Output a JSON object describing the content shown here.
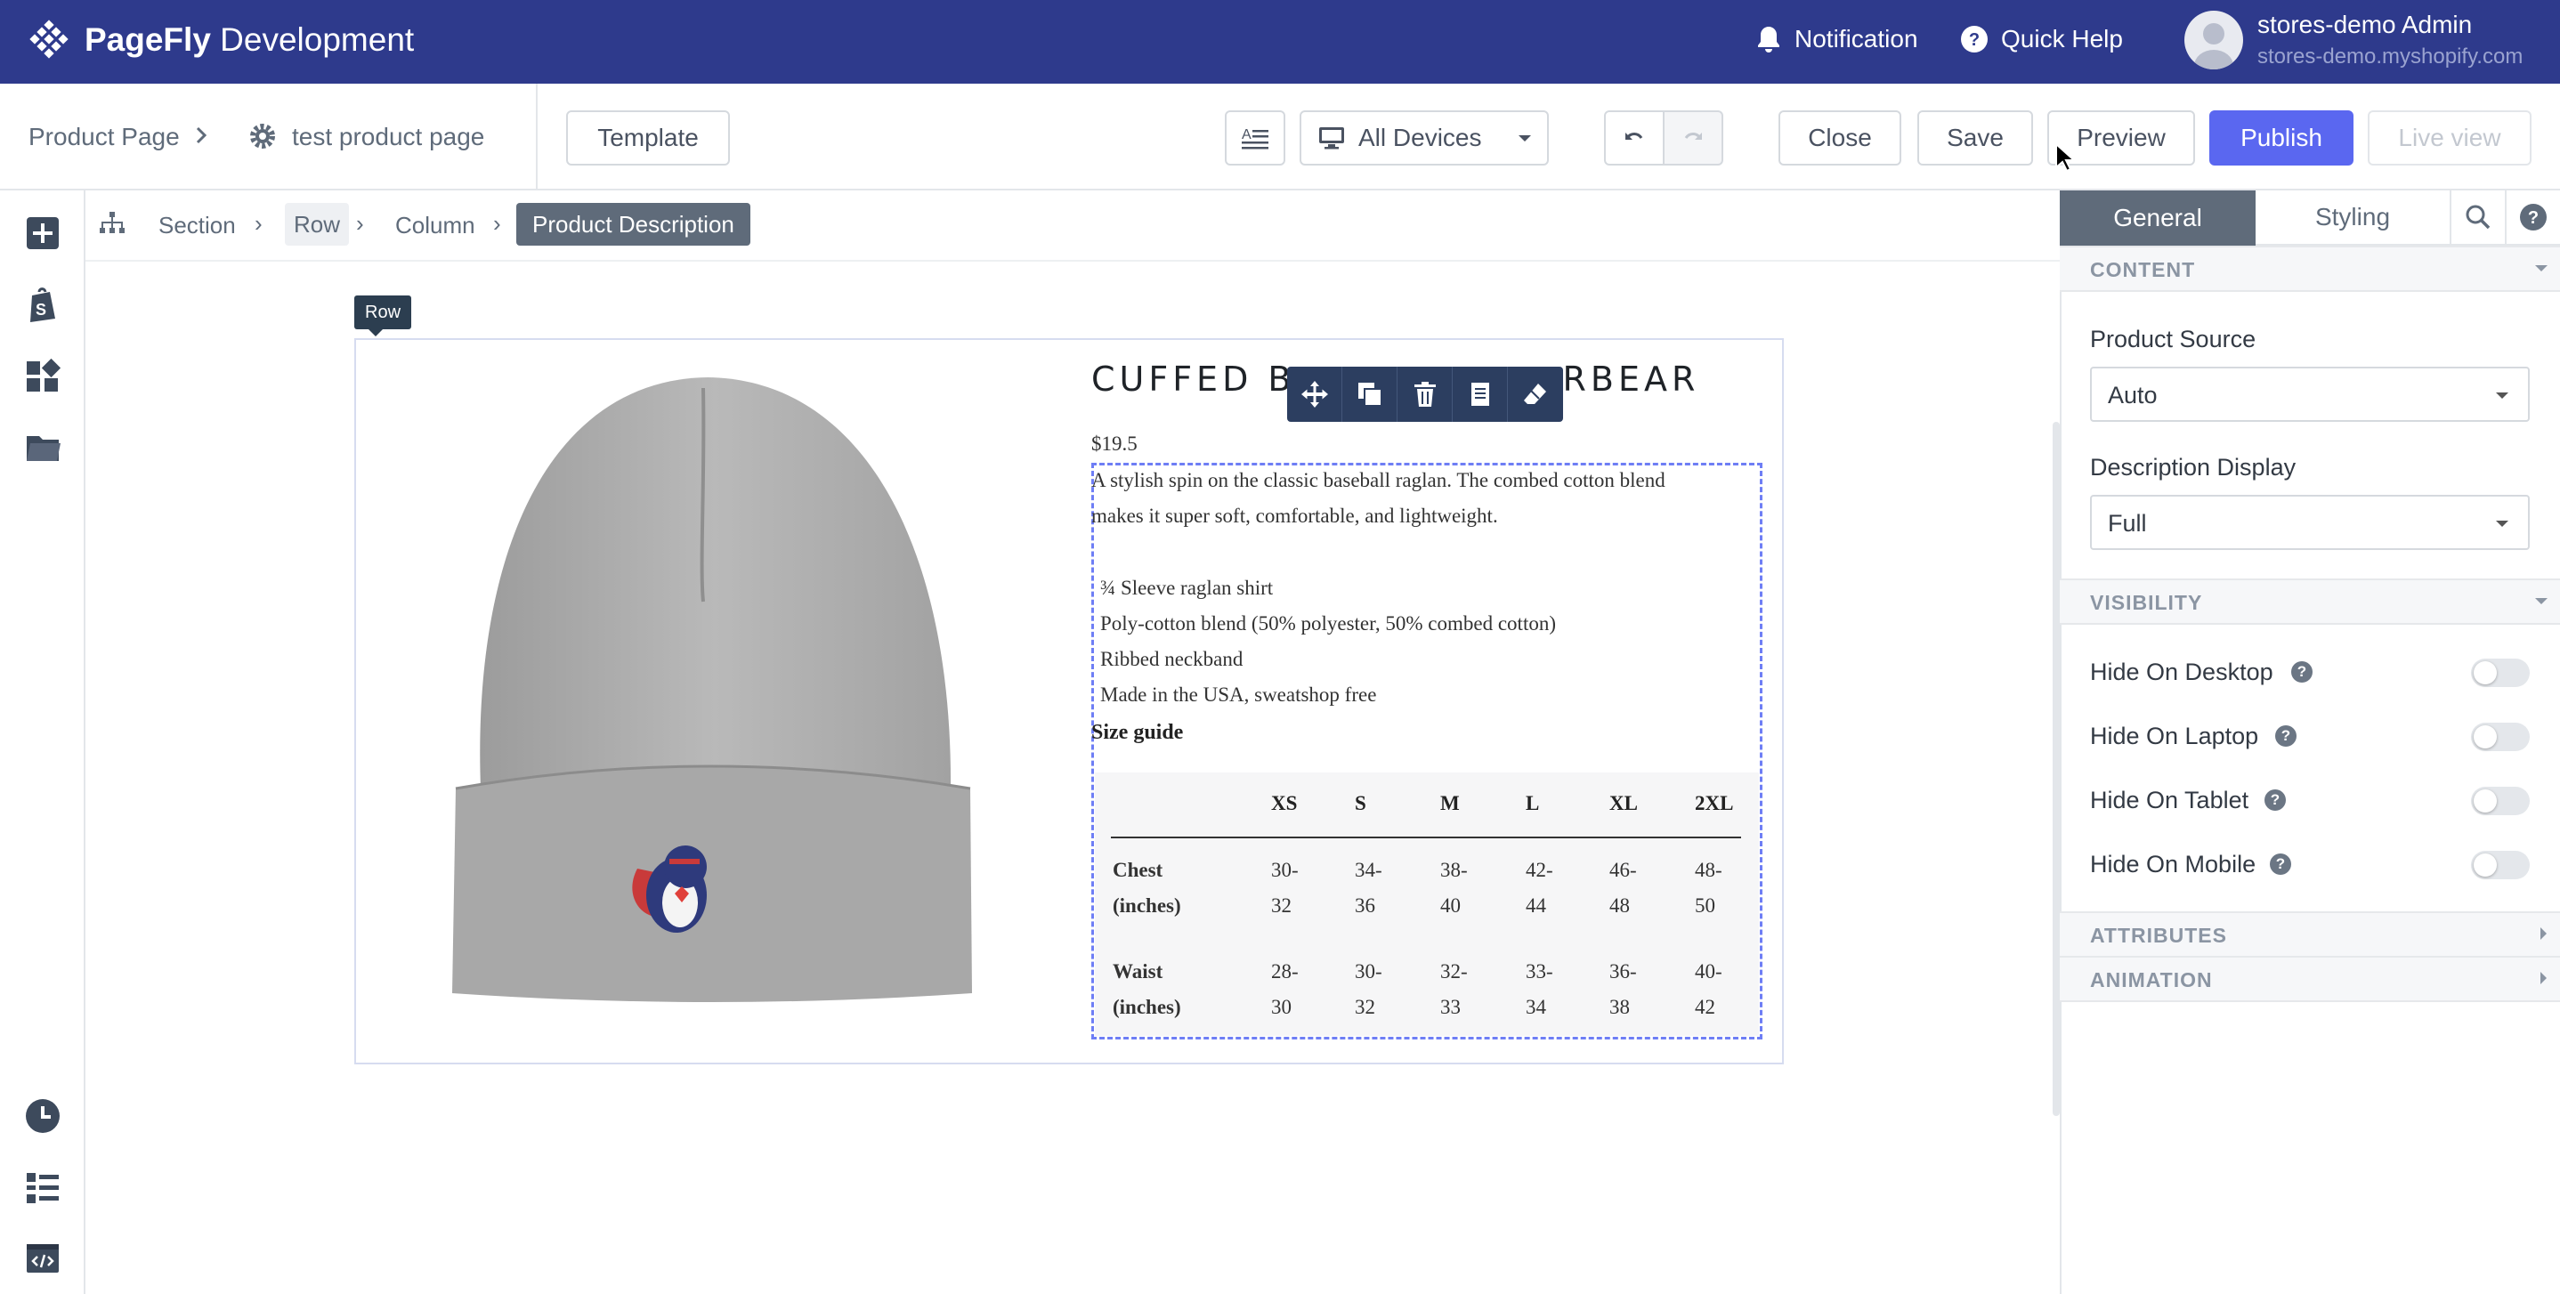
{
  "app": {
    "brand_bold": "PageFly",
    "brand_rest": " Development",
    "notification_label": "Notification",
    "quick_help_label": "Quick Help",
    "user_name": "stores-demo Admin",
    "user_domain": "stores-demo.myshopify.com",
    "colors": {
      "topbar": "#2e3a8c",
      "accent": "#5a67f0",
      "active_tab": "#5f6b7a"
    }
  },
  "toolbar": {
    "crumb_parent": "Product Page",
    "crumb_page": "test product page",
    "template_label": "Template",
    "device_label": "All Devices",
    "close_label": "Close",
    "save_label": "Save",
    "preview_label": "Preview",
    "publish_label": "Publish",
    "live_view_label": "Live view"
  },
  "breadcrumb": [
    "Section",
    "Row",
    "Column",
    "Product Description"
  ],
  "canvas": {
    "row_label": "Row",
    "product_title": "CUFFED BEANIE SUPERBEAR",
    "title_left": "CUFFED B",
    "title_right": "RBEAR",
    "price": "$19.5",
    "description_lines": [
      "A stylish spin on the classic baseball raglan. The combed cotton blend",
      "makes it super soft, comfortable, and lightweight.",
      "¾ Sleeve raglan shirt",
      "Poly-cotton blend (50% polyester, 50% combed cotton)",
      "Ribbed neckband",
      "Made in the USA, sweatshop free"
    ],
    "size_guide_title": "Size guide",
    "size_table": {
      "headers": [
        "",
        "XS",
        "S",
        "M",
        "L",
        "XL",
        "2XL"
      ],
      "rows": [
        {
          "label_1": "Chest",
          "label_2": "(inches)",
          "cells": [
            [
              "30-",
              "32"
            ],
            [
              "34-",
              "36"
            ],
            [
              "38-",
              "40"
            ],
            [
              "42-",
              "44"
            ],
            [
              "46-",
              "48"
            ],
            [
              "48-",
              "50"
            ]
          ]
        },
        {
          "label_1": "Waist",
          "label_2": "(inches)",
          "cells": [
            [
              "28-",
              "30"
            ],
            [
              "30-",
              "32"
            ],
            [
              "32-",
              "33"
            ],
            [
              "33-",
              "34"
            ],
            [
              "36-",
              "38"
            ],
            [
              "40-",
              "42"
            ]
          ]
        }
      ]
    },
    "element_toolbar_icons": [
      "move-icon",
      "duplicate-icon",
      "delete-icon",
      "copy-style-icon",
      "eraser-icon"
    ]
  },
  "panel": {
    "tab_general": "General",
    "tab_styling": "Styling",
    "help_glyph": "?",
    "sections": {
      "content": "CONTENT",
      "visibility": "VISIBILITY",
      "attributes": "ATTRIBUTES",
      "animation": "ANIMATION"
    },
    "product_source_label": "Product Source",
    "product_source_value": "Auto",
    "description_display_label": "Description Display",
    "description_display_value": "Full",
    "visibility_toggles": [
      {
        "label": "Hide On Desktop",
        "on": false
      },
      {
        "label": "Hide On Laptop",
        "on": false
      },
      {
        "label": "Hide On Tablet",
        "on": false
      },
      {
        "label": "Hide On Mobile",
        "on": false
      }
    ]
  }
}
